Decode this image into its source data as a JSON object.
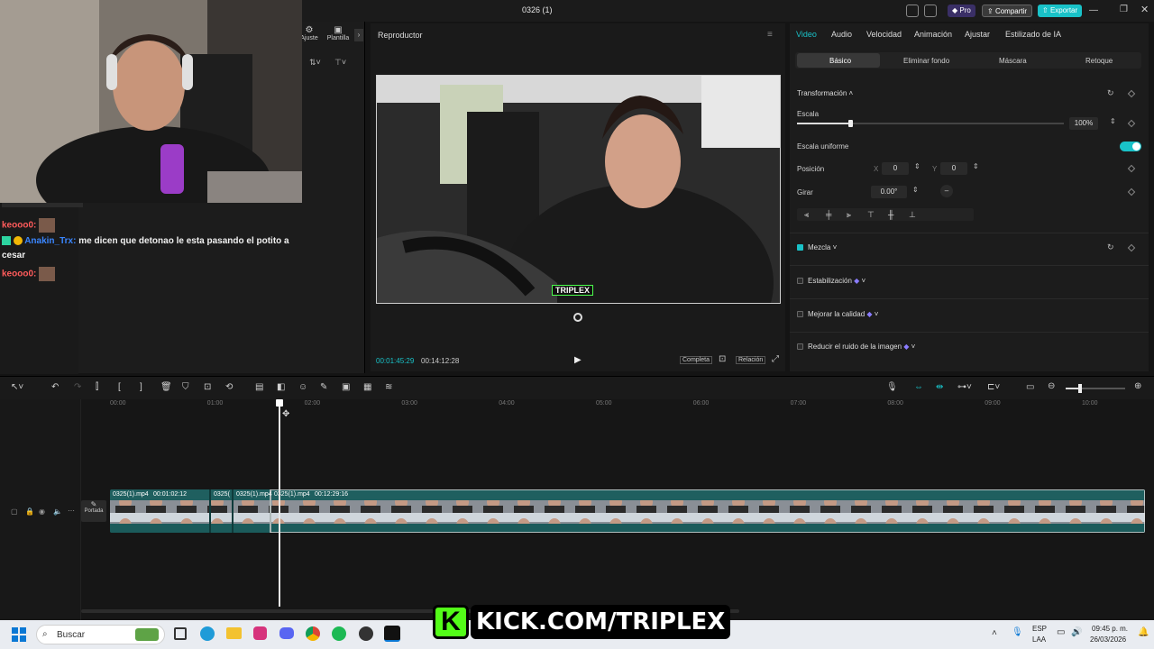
{
  "window": {
    "title": "0326 (1)",
    "pro_label": "Pro",
    "share_label": "Compartir",
    "export_label": "Exportar"
  },
  "left_panel": {
    "tabs": [
      "Ajuste",
      "Plantilla"
    ]
  },
  "chat": {
    "messages": [
      {
        "user": "keooo0:",
        "color": "#ff5b5b"
      },
      {
        "user": "Anakin_Trx:",
        "color": "#3a86ff",
        "text": "me dicen que detonao le esta pasando el potito a",
        "text2": "cesar"
      },
      {
        "user": "keooo0:",
        "color": "#ff5b5b"
      }
    ]
  },
  "player": {
    "header": "Reproductor",
    "watermark": "TRIPLEX",
    "current_time": "00:01:45:29",
    "total_time": "00:14:12:28",
    "full_label": "Completa",
    "ratio_label": "Relación"
  },
  "inspector": {
    "tabs": [
      "Video",
      "Audio",
      "Velocidad",
      "Animación",
      "Ajustar",
      "Estilizado de IA"
    ],
    "subtabs": [
      "Básico",
      "Eliminar fondo",
      "Máscara",
      "Retoque"
    ],
    "transform_title": "Transformación",
    "scale_label": "Escala",
    "scale_value": "100%",
    "scale_fraction": 0.2,
    "uniform_label": "Escala uniforme",
    "position_label": "Posición",
    "pos_x_label": "X",
    "pos_x": "0",
    "pos_y_label": "Y",
    "pos_y": "0",
    "rotate_label": "Girar",
    "rotate_value": "0.00°",
    "blend_label": "Mezcla",
    "stabilize_label": "Estabilización",
    "quality_label": "Mejorar la calidad",
    "denoise_label": "Reducir el ruido de la imagen",
    "accent": "#19c2c8"
  },
  "timeline": {
    "ticks": [
      "00:00",
      "01:00",
      "02:00",
      "03:00",
      "04:00",
      "05:00",
      "06:00",
      "07:00",
      "08:00",
      "09:00",
      "10:00"
    ],
    "cover_label": "Portada",
    "clips": [
      {
        "name": "0325(1).mp4",
        "duration": "00:01:02:12"
      },
      {
        "name": "0325("
      },
      {
        "name": "0325(1).mp4"
      },
      {
        "name": "0325(1).mp4",
        "duration": "00:12:29:16"
      }
    ]
  },
  "taskbar": {
    "search_placeholder": "Buscar",
    "lang": "ESP",
    "lang2": "LAA",
    "time": "09:45 p. m.",
    "date": "26/03/2026"
  },
  "overlay": {
    "kick_text": "KICK.COM/TRIPLEX"
  }
}
